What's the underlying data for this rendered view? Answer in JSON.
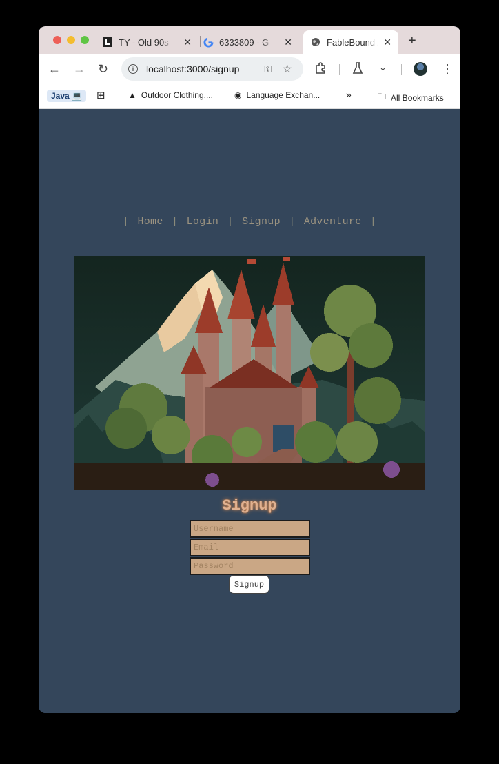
{
  "browser": {
    "tabs": [
      {
        "title": "TY - Old 90s",
        "icon": "letter-l-favicon"
      },
      {
        "title": "6333809 - G",
        "icon": "google-favicon"
      },
      {
        "title": "FableBound A",
        "icon": "globe-favicon",
        "active": true
      }
    ],
    "url": "localhost:3000/signup",
    "bookmarks": [
      {
        "label": "Java 💻"
      },
      {
        "label": "Outdoor Clothing,..."
      },
      {
        "label": "Language Exchan..."
      },
      {
        "label": "All Bookmarks"
      }
    ]
  },
  "page": {
    "nav": {
      "items": [
        "Home",
        "Login",
        "Signup",
        "Adventure"
      ],
      "separator": "|"
    },
    "hero_image": "pixel-art-castle-in-forest",
    "form": {
      "title": "Signup",
      "username_placeholder": "Username",
      "email_placeholder": "Email",
      "password_placeholder": "Password",
      "submit_label": "Signup"
    },
    "colors": {
      "background": "#34465b",
      "title_glow": "#e0b191",
      "input_bg": "#caa785"
    }
  }
}
